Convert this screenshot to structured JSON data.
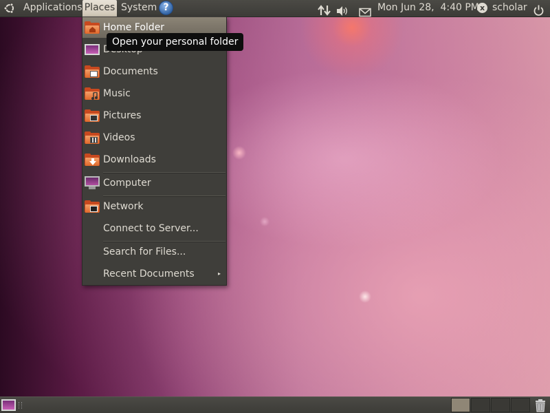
{
  "top_panel": {
    "applications_label": "Applications",
    "places_label": "Places",
    "system_label": "System",
    "help_glyph": "?",
    "clock": "Mon Jun 28,  4:40 PM",
    "user_name": "scholar",
    "user_status_glyph": "x",
    "icons": [
      "ubuntu-logo-icon",
      "help-icon",
      "network-arrows-icon",
      "volume-icon",
      "mail-icon",
      "user-status-icon",
      "power-icon"
    ]
  },
  "places_menu": {
    "items": [
      {
        "label": "Home Folder",
        "icon": "home-folder-icon",
        "highlighted": true
      },
      {
        "label": "Desktop",
        "icon": "desktop-icon"
      },
      {
        "label": "Documents",
        "icon": "documents-folder-icon"
      },
      {
        "label": "Music",
        "icon": "music-folder-icon"
      },
      {
        "label": "Pictures",
        "icon": "pictures-folder-icon"
      },
      {
        "label": "Videos",
        "icon": "videos-folder-icon"
      },
      {
        "label": "Downloads",
        "icon": "downloads-folder-icon"
      },
      {
        "label": "Computer",
        "icon": "computer-icon"
      },
      {
        "label": "Network",
        "icon": "network-folder-icon"
      },
      {
        "label": "Connect to Server..."
      },
      {
        "label": "Search for Files..."
      },
      {
        "label": "Recent Documents",
        "has_submenu": true
      }
    ],
    "submenu_arrow": "▸"
  },
  "tooltip": {
    "text": "Open your personal folder"
  },
  "bottom_panel": {
    "workspaces": 4,
    "active_workspace": 1,
    "icons": [
      "show-desktop-icon",
      "trash-icon"
    ]
  },
  "colors": {
    "panel": "#3c3b37",
    "menu_bg": "#3f3e3a",
    "highlight": "#7d7669",
    "folder_orange": "#e0682a",
    "tooltip_bg": "#0e0e0e"
  }
}
